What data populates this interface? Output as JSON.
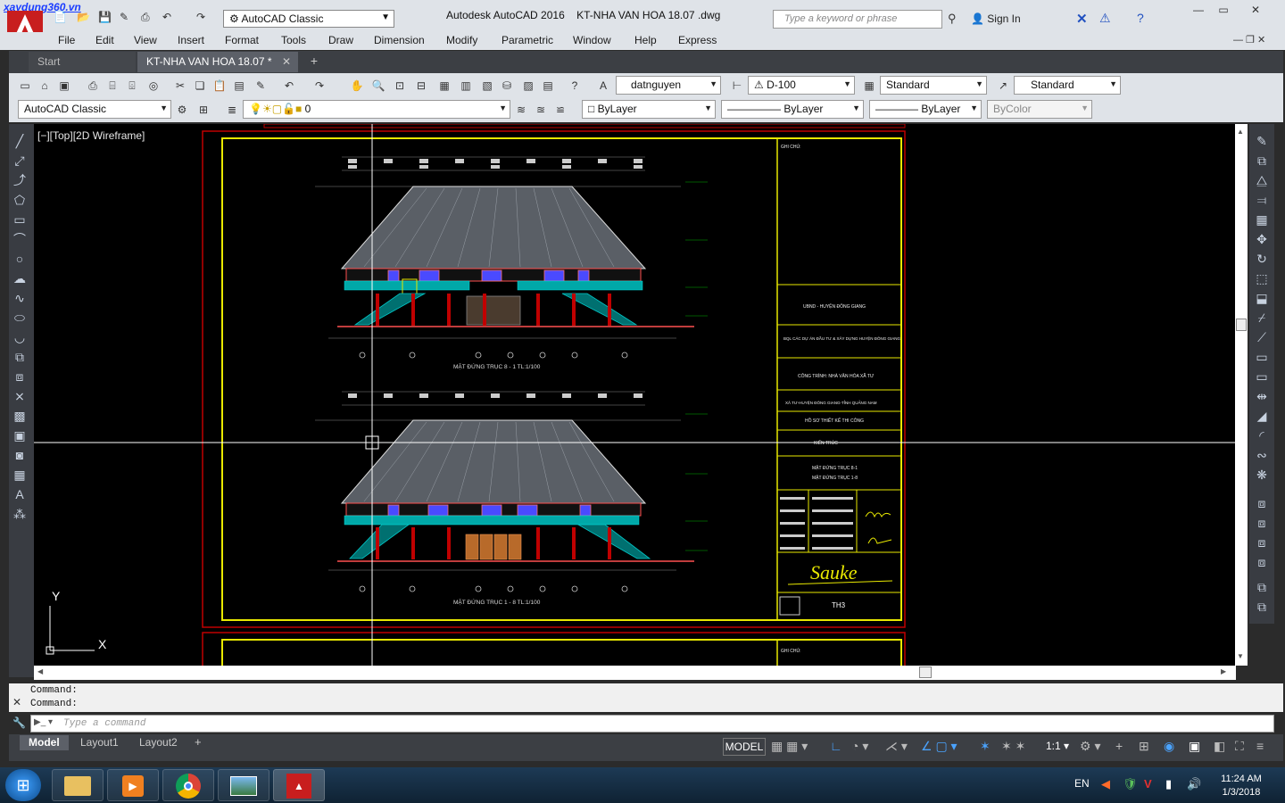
{
  "watermark": "xaydung360.vn",
  "titlebar": {
    "workspace": "AutoCAD Classic",
    "app_title": "Autodesk AutoCAD 2016",
    "file_title": "KT-NHA VAN HOA 18.07 .dwg",
    "search_placeholder": "Type a keyword or phrase",
    "sign_in": "Sign In"
  },
  "menu": [
    "File",
    "Edit",
    "View",
    "Insert",
    "Format",
    "Tools",
    "Draw",
    "Dimension",
    "Modify",
    "Parametric",
    "Window",
    "Help",
    "Express"
  ],
  "tabs": {
    "start": "Start",
    "file": "KT-NHA VAN HOA 18.07 *"
  },
  "toolbar1": {
    "text_style": "datnguyen",
    "dim_style": "D-100",
    "table_style": "Standard",
    "mleader_style": "Standard"
  },
  "toolbar2": {
    "workspace": "AutoCAD Classic",
    "layer": "0",
    "color": "ByLayer",
    "linetype": "ByLayer",
    "lineweight": "ByLayer",
    "plotstyle": "ByColor"
  },
  "viewport": {
    "label": "[−][Top][2D Wireframe]"
  },
  "drawing": {
    "elevation1_title": "MẶT ĐỨNG TRỤC 8 - 1 TL:1/100",
    "elevation2_title": "MẶT ĐỨNG TRỤC 1 - 8 TL:1/100",
    "title_block": {
      "row1": "GHI CHÚ:",
      "row2": "UBND - HUYỆN ĐÔNG GIANG",
      "row3": "BQL CÁC DỰ ÁN ĐẦU TƯ & XÂY DỰNG HUYỆN ĐÔNG GIANG",
      "row4": "CÔNG TRÌNH: NHÀ VĂN HÓA XÃ TƯ",
      "row5": "XÃ TƯ-HUYỆN ĐÔNG GIANG-TỈNH QUẢNG NAM",
      "row6": "HỒ SƠ THIẾT KẾ THI CÔNG",
      "row7": "KIẾN TRÚC",
      "row8a": "MẶT ĐỨNG TRỤC 8-1",
      "row8b": "MẶT ĐỨNG TRỤC 1-8",
      "sheet": "TH3",
      "signature": "Sauke"
    }
  },
  "command": {
    "line1": "Command:",
    "line2": "Command:",
    "placeholder": "Type a command"
  },
  "layout_tabs": [
    "Model",
    "Layout1",
    "Layout2"
  ],
  "status": {
    "model": "MODEL",
    "scale": "1:1"
  },
  "taskbar": {
    "lang": "EN",
    "time": "11:24 AM",
    "date": "1/3/2018"
  },
  "colors": {
    "frame_red": "#c00000",
    "frame_yellow": "#e8e800",
    "roof": "#9aa0a8",
    "railing": "#00c8c8",
    "window": "#4a4aff",
    "door": "#b86a2a",
    "wall": "#ff5050"
  }
}
